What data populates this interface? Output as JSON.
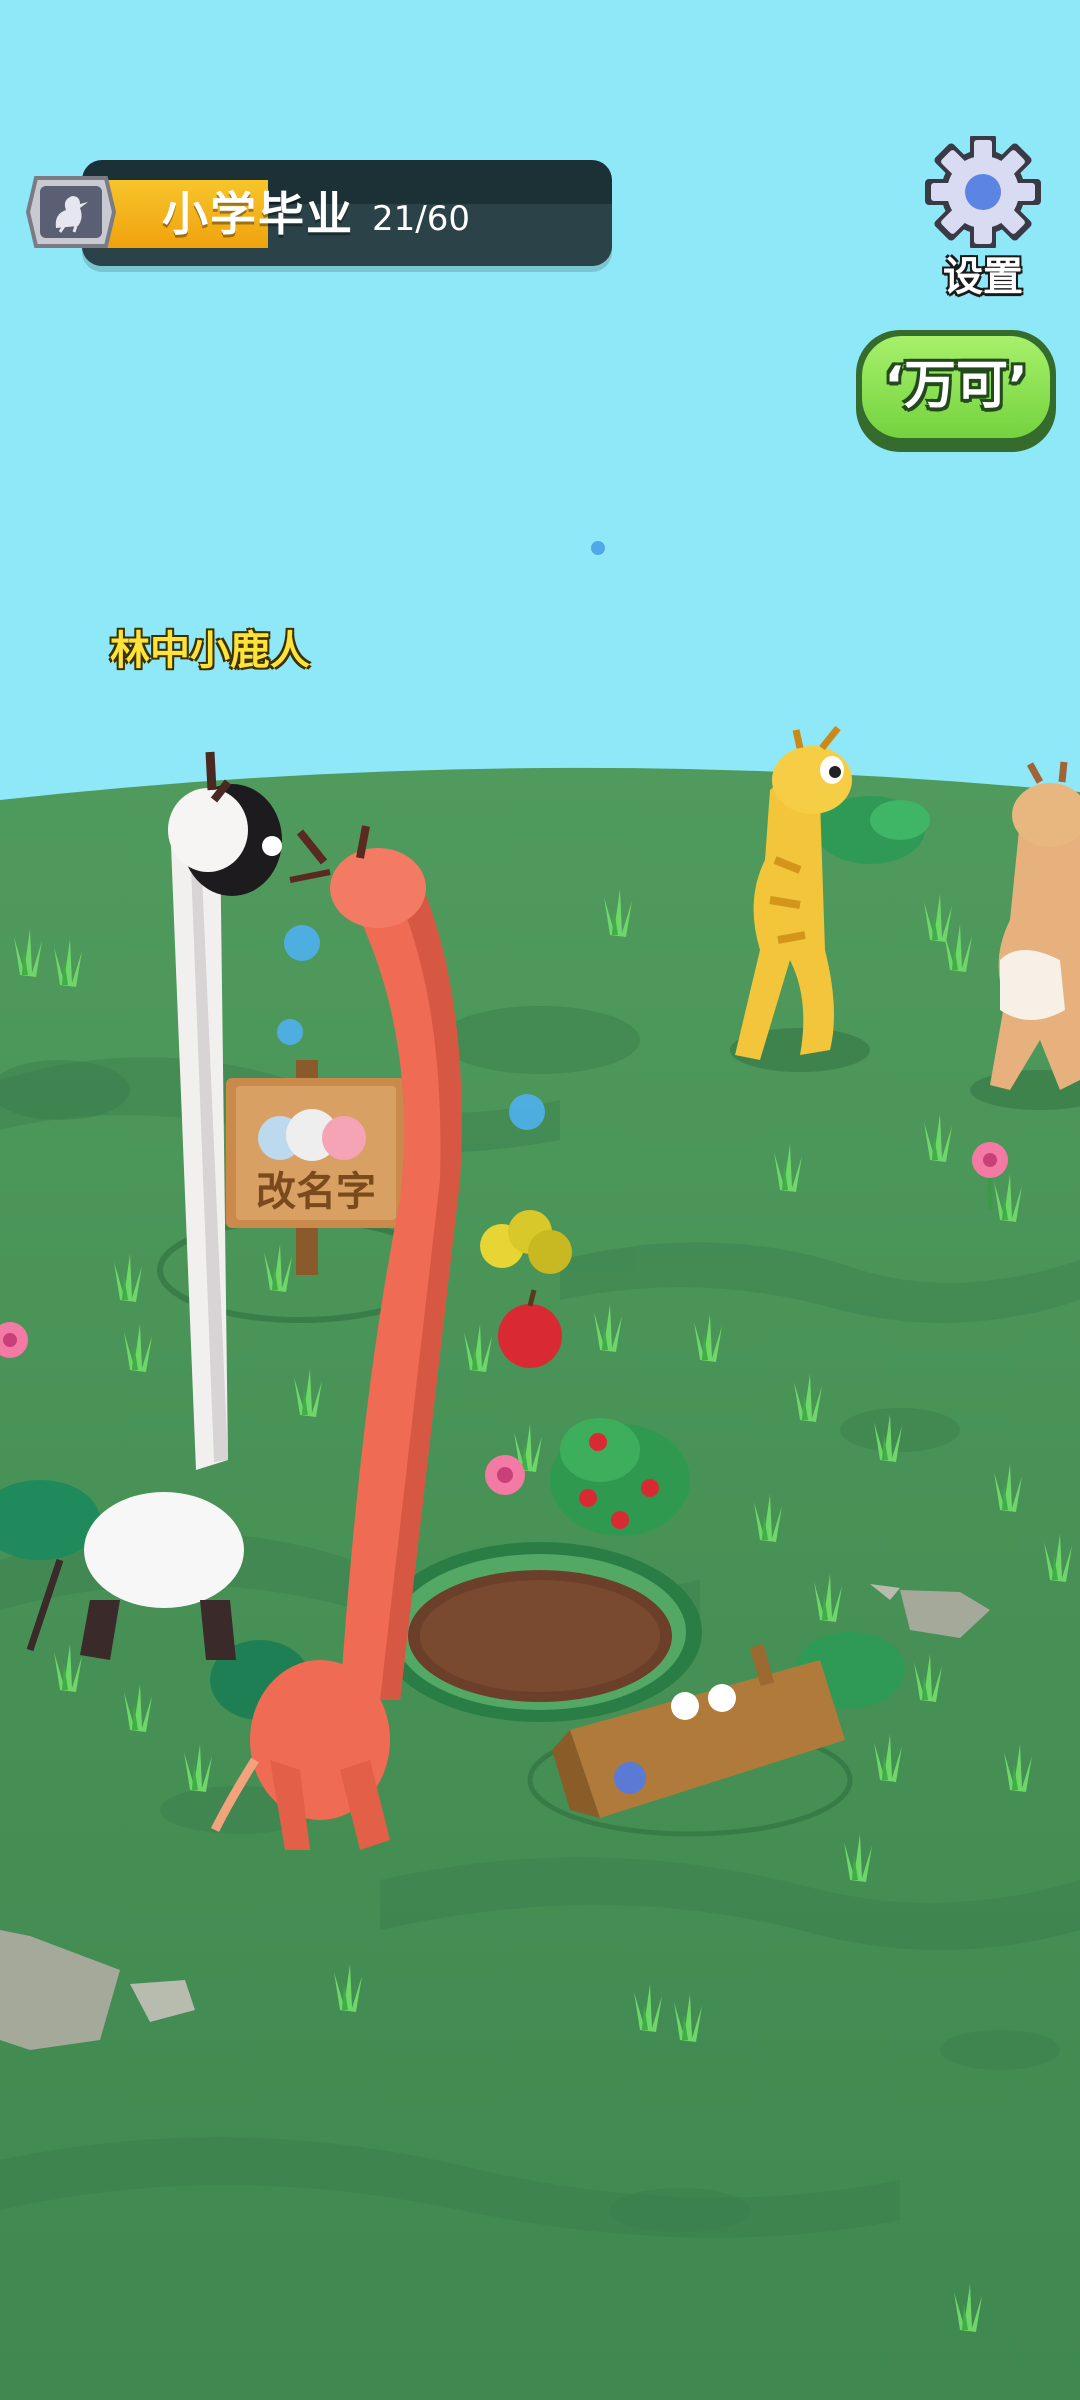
{
  "hud": {
    "level_title": "小学毕业",
    "progress_text": "21/60",
    "progress_value": 21,
    "progress_max": 60,
    "badge_icon": "goose-icon"
  },
  "settings": {
    "label": "设置",
    "icon": "gear-icon"
  },
  "actions": {
    "wanke_label": "‘万可’"
  },
  "player": {
    "name": "林中小鹿人"
  },
  "sign": {
    "label": "改名字"
  },
  "colors": {
    "sky": "#8fe8f8",
    "ground": "#418a52",
    "progress_fill": "#f4b21a",
    "button_green": "#8de257",
    "name_yellow": "#ffe33a"
  }
}
